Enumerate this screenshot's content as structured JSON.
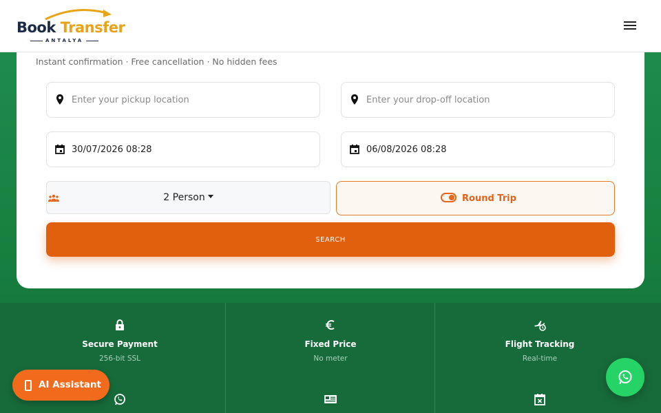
{
  "brand": {
    "word1": "Book",
    "word2": "Transfer",
    "sub": "ANTALYA"
  },
  "header": {
    "menu_icon": "hamburger-menu-icon"
  },
  "form": {
    "tagline": "Instant confirmation · Free cancellation · No hidden fees",
    "pickup": {
      "placeholder": "Enter your pickup location",
      "icon": "map-pin-icon"
    },
    "dropoff": {
      "placeholder": "Enter your drop-off location",
      "icon": "map-pin-icon"
    },
    "pickup_date": {
      "value": "30/07/2026 08:28",
      "icon": "calendar-icon"
    },
    "return_date": {
      "value": "06/08/2026 08:28",
      "icon": "calendar-icon"
    },
    "passengers": {
      "value": "2 Person",
      "icon": "people-icon"
    },
    "round_trip": {
      "label": "Round Trip",
      "enabled": true
    },
    "search_label": "SEARCH"
  },
  "features": [
    {
      "title": "Secure Payment",
      "sub": "256-bit SSL",
      "icon": "lock-icon"
    },
    {
      "title": "Fixed Price",
      "sub": "No meter",
      "icon": "euro-icon"
    },
    {
      "title": "Flight Tracking",
      "sub": "Real-time",
      "icon": "flight-clock-icon"
    }
  ],
  "ai_assistant": {
    "label": "AI Assistant",
    "icon": "phone-icon"
  },
  "whatsapp": {
    "icon": "whatsapp-icon"
  },
  "colors": {
    "accent": "#e0600d",
    "brand_green": "#176b3a",
    "whatsapp": "#25d366"
  }
}
